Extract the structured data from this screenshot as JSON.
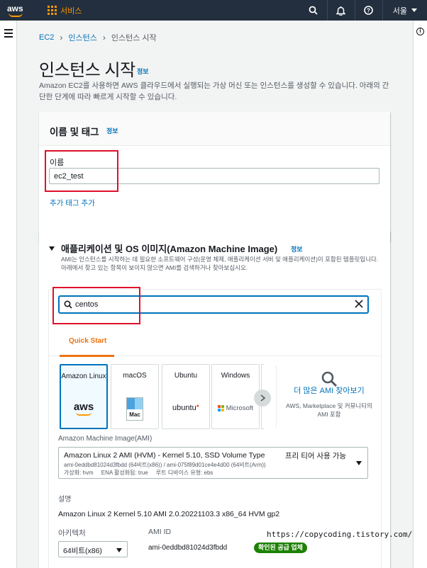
{
  "topnav": {
    "logo_text": "aws",
    "services_label": "서비스",
    "region_label": "서울",
    "icons": [
      "search-icon",
      "bell-icon",
      "help-icon",
      "grid-icon"
    ],
    "colors": {
      "bg": "#232f3e",
      "accent": "#ff9900"
    }
  },
  "breadcrumb": {
    "items": [
      "EC2",
      "인스턴스",
      "인스턴스 시작"
    ]
  },
  "page": {
    "title": "인스턴스 시작",
    "info_link": "정보",
    "description": "Amazon EC2를 사용하면 AWS 클라우드에서 실행되는 가상 머신 또는 인스턴스를 생성할 수 있습니다. 아래의 간단한 단계에 따라 빠르게 시작할 수 있습니다."
  },
  "name_panel": {
    "title": "이름 및 태그",
    "info_link": "정보",
    "name_label": "이름",
    "name_value": "ec2_test",
    "add_tag_link": "추가 태그 추가"
  },
  "ami_panel": {
    "title": "애플리케이션 및 OS 이미지(Amazon Machine Image)",
    "info_link": "정보",
    "description": "AMI는 인스턴스를 시작하는 데 필요한 소프트웨어 구성(운영 체제, 애플리케이션 서버 및 애플리케이션)이 포함된 템플릿입니다. 아래에서 찾고 있는 항목이 보이지 않으면 AMI를 검색하거나 찾아보십시오.",
    "search_value": "centos",
    "tab_label": "Quick Start",
    "os_tiles": [
      {
        "name": "Amazon Linux",
        "logo": "aws"
      },
      {
        "name": "macOS",
        "logo": "Mac"
      },
      {
        "name": "Ubuntu",
        "logo": "ubuntu"
      },
      {
        "name": "Windows",
        "logo": "Microsoft"
      }
    ],
    "more_amis_link": "더 많은 AMI 찾아보기",
    "more_amis_sub": "AWS, Marketplace 및 커뮤니티의 AMI 포함",
    "ami_select_label": "Amazon Machine Image(AMI)",
    "ami_selected": {
      "name": "Amazon Linux 2 AMI (HVM) - Kernel 5.10, SSD Volume Type",
      "tier": "프리 티어 사용 가능",
      "ids": "ami-0eddbd81024d3fbdd (64비트(x86)) / ami-075f89d01ce4e4d00 (64비트(Arm))",
      "meta": "가상화: hvm     ENA 활성화됨: true     루트 디바이스 유형: ebs"
    },
    "desc_label": "설명",
    "desc_value": "Amazon Linux 2 Kernel 5.10 AMI 2.0.20221103.3 x86_64 HVM gp2",
    "arch_label": "아키텍처",
    "arch_value": "64비트(x86)",
    "ami_id_label": "AMI ID",
    "ami_id_value": "ami-0eddbd81024d3fbdd",
    "verified_badge": "확인된 공급 업체"
  },
  "watermark": "https://copycoding.tistory.com/"
}
